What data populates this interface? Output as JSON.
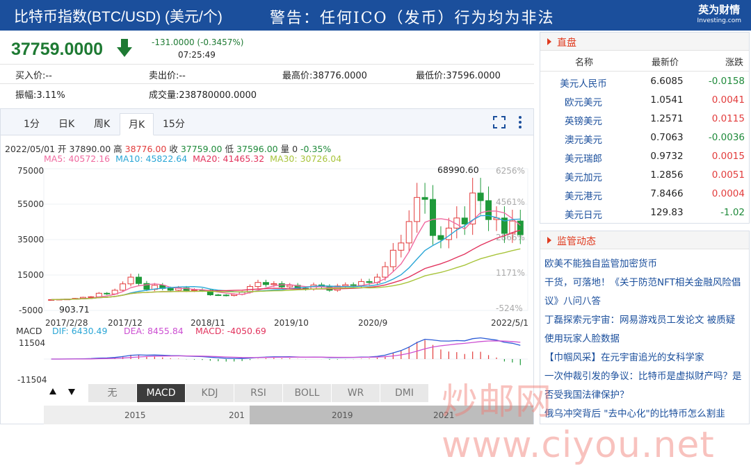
{
  "header": {
    "title": "比特币指数(BTC/USD) (美元/个)",
    "warning": "警告：任何ICO（发币）行为均为非法",
    "brand": "英为财情",
    "brand_sub": "Investing.com"
  },
  "quote": {
    "price": "37759.0000",
    "change": "-131.0000 (-0.3457%)",
    "time": "07:25:49"
  },
  "stats": {
    "bid": "买入价:--",
    "ask": "卖出价:--",
    "high": "最高价:38776.0000",
    "low": "最低价:37596.0000",
    "amplitude": "振幅:3.11%",
    "volume": "成交量:238780000.0000"
  },
  "tabs": [
    "1分",
    "日K",
    "周K",
    "月K",
    "15分"
  ],
  "ohlc": {
    "date": "2022/05/01",
    "open_label": "开",
    "open": "37890.00",
    "high_label": "高",
    "high": "38776.00",
    "close_label": "收",
    "close": "37759.00",
    "low_label": "低",
    "low": "37596.00",
    "vol_label": "量",
    "vol": "0",
    "pct": "-0.35%"
  },
  "ma": {
    "ma5": "MA5: 40572.16",
    "ma10": "MA10: 45822.64",
    "ma20": "MA20: 41465.32",
    "ma30": "MA30: 30726.04",
    "colors": {
      "ma5": "#f06aa0",
      "ma10": "#2aa6d6",
      "ma20": "#e2335d",
      "ma30": "#a8c43a"
    }
  },
  "chart_data": {
    "type": "candlestick",
    "y_ticks": [
      "75000",
      "55000",
      "35000",
      "15000",
      "-5000"
    ],
    "pct_ticks": [
      "6256%",
      "4561%",
      "2866%",
      "1171%",
      "-524%"
    ],
    "x_ticks": [
      "2017/2/28",
      "2017/12",
      "2018/11",
      "2019/10",
      "2020/9",
      "2022/5/1"
    ],
    "ylim": [
      -5000,
      75000
    ],
    "max_label": "68990.60",
    "min_label": "903.71",
    "macd": {
      "label": "MACD",
      "dif": "DIF: 6430.49",
      "dea": "DEA: 8455.84",
      "macd": "MACD: -4050.69",
      "ticks": [
        "11504",
        "-11504"
      ]
    },
    "close": [
      1100,
      1300,
      1400,
      1800,
      2400,
      2700,
      4700,
      4300,
      6400,
      10000,
      13800,
      10200,
      6900,
      9200,
      7400,
      6400,
      7700,
      6300,
      6600,
      6400,
      3800,
      3700,
      3400,
      4100,
      5300,
      8500,
      10800,
      9600,
      10100,
      8300,
      9200,
      7500,
      7200,
      9400,
      8600,
      6400,
      8800,
      9500,
      9100,
      11300,
      10800,
      13800,
      19700,
      29000,
      33100,
      45200,
      58800,
      57700,
      37300,
      35000,
      41500,
      47200,
      43800,
      61300,
      57000,
      46300,
      47200,
      38500,
      45500,
      37759
    ]
  },
  "indicators": [
    "无",
    "MACD",
    "KDJ",
    "RSI",
    "BOLL",
    "WR",
    "DMI"
  ],
  "timeline": [
    "2015",
    "201",
    "2019",
    "2021"
  ],
  "market": {
    "title": "直盘",
    "headers": [
      "名称",
      "最新价",
      "涨跌"
    ],
    "rows": [
      {
        "name": "美元人民币",
        "price": "6.6085",
        "change": "-0.0158",
        "up": false
      },
      {
        "name": "欧元美元",
        "price": "1.0541",
        "change": "0.0041",
        "up": true
      },
      {
        "name": "英镑美元",
        "price": "1.2571",
        "change": "0.0115",
        "up": true
      },
      {
        "name": "澳元美元",
        "price": "0.7063",
        "change": "-0.0036",
        "up": false
      },
      {
        "name": "美元瑞郎",
        "price": "0.9732",
        "change": "0.0015",
        "up": true
      },
      {
        "name": "美元加元",
        "price": "1.2856",
        "change": "0.0051",
        "up": true
      },
      {
        "name": "美元港元",
        "price": "7.8466",
        "change": "0.0004",
        "up": true
      },
      {
        "name": "美元日元",
        "price": "129.83",
        "change": "-1.02",
        "up": false
      }
    ]
  },
  "news": {
    "title": "监管动态",
    "items": [
      "欧美不能独自监管加密货币",
      "干货，可落地！《关于防范NFT相关金融风险倡",
      "议》八问八答",
      "丁磊探索元宇宙：网易游戏员工发论文 被质疑",
      "使用玩家人脸数据",
      "【巾帼风采】在元宇宙追光的女科学家",
      "一次仲裁引发的争议：比特币是虚拟财产吗？是",
      "否受我国法律保护？",
      "俄乌冲突背后 \"去中心化\"的比特币怎么割韭"
    ]
  },
  "watermark": "炒邮网 www.ciyou.net"
}
